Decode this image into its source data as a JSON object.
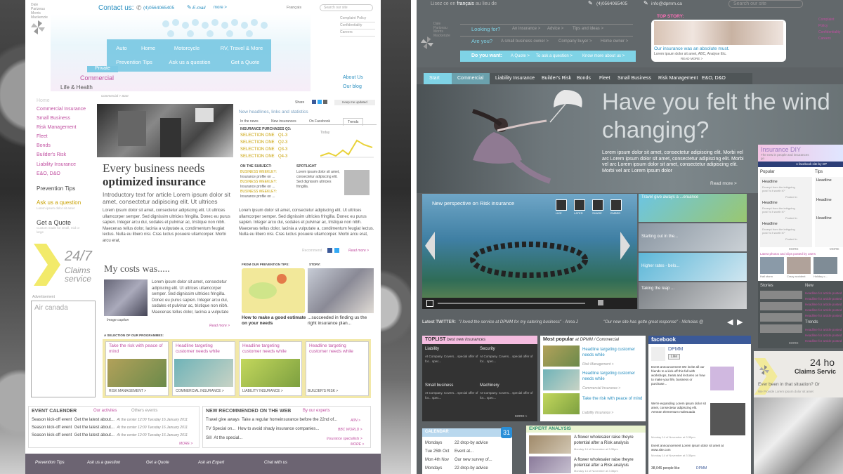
{
  "left": {
    "logo_lines": [
      "Dale",
      "Parizeau",
      "Morris",
      "Mackenzie"
    ],
    "contact_label": "Contact us:",
    "phone": "(4)0564065405",
    "email": "E-mail",
    "more": "more >",
    "lang": "Français",
    "search_placeholder": "Search our site",
    "util_links": [
      "Complaint Policy",
      "Confidentiality",
      "Careers"
    ],
    "nav_row1": [
      "Auto",
      "Home",
      "Motorcycle",
      "RV, Travel & More"
    ],
    "nav_row2": [
      "Prevention Tips",
      "Ask us a question",
      "Get a Quote"
    ],
    "private_tab": "Private",
    "commercial_tab": "Commercial",
    "life_tab": "Life & Health",
    "about_links": [
      "About Us",
      "Our blog"
    ],
    "breadcrumb": "Commercial > Start",
    "share": "Share",
    "keep_updated": "Keep me updated",
    "sidebar_items": [
      "Home",
      "Commercial Insurance",
      "Small Business",
      "Risk Management",
      "Fleet",
      "Bonds",
      "Builder's Risk",
      "Liability Insurance",
      "E&O, D&O"
    ],
    "prevention_tips": "Prevention Tips",
    "ask_question": "Ask us a question",
    "ask_sub": "Lorem ipsum dolor sit amet",
    "get_quote": "Get a Quote",
    "quote_sub": "Custom made for small, mid or large",
    "claims_num": "24/7",
    "claims_text1": "Claims",
    "claims_text2": "service",
    "advert_label": "Advertisement",
    "advert_name": "Air canada",
    "headline1": "Every business needs",
    "headline2": "optimized insurance",
    "intro": "Introductory text for article Lorem ipsum dolor sit amet, consectetur adipiscing elit. Ut ultrices",
    "body": "Lorem ipsum dolor sit amet, consectetur adipiscing elit. Ut ultrices ullamcorper semper. Sed dignissim ultricies fringilla. Donec eu purus sapien. Integer arcu dui, sodales et pulvinar ac, tristique non nibh. Maecenas tellus dolor, lacinia a vulputate a, condimentum feugiat lectus. Nulla eu libero nisi. Cras luctus posuere ullamcorper. Morbi arcu erat,",
    "news_title": "New headlines, links and statistics",
    "news_tabs": [
      "In the news",
      "New insurances",
      "On Facebook",
      "Trends"
    ],
    "purchases_title": "INSURANCE PURCHASES Q3:",
    "selections": [
      "SELECTION ONE",
      "SELECTION ONE",
      "SELECTION ONE",
      "SELECTION ONE"
    ],
    "quarters": [
      "Q1-3",
      "Q2-3",
      "Q3-3",
      "Q4-3"
    ],
    "today": "Today",
    "on_subject": "ON THE SUBJECT:",
    "spotlight": "SPOTLIGHT",
    "biz_weekly": "BUSINESS WEEKLEY:",
    "biz_text": "Insurance profile on ...",
    "spot_text": "Lorem ipsum dolor sit amet, consectetur adipiscing elit. Sed dignissim ultricies fringilla.",
    "news_body": "Lorem ipsum dolor sit amet, consectetur adipiscing elit. Ut ultrices ullamcorper semper. Sed dignissim ultricies fringilla. Donec eu purus sapien. Integer arcu dui, sodales et pulvinar ac, tristique non nibh. Maecenas tellus dolor, lacinia a vulputate a, condimentum feugiat lectus. Nulla eu libero nisi. Cras luctus posuere ullamcorper. Morbi arcu erat,",
    "recommend": "Recommend",
    "read_more": "Read more >",
    "costs_title": "My costs was.....",
    "costs_body": "Lorem ipsum dolor sit amet, consectetur adipiscing elit. Ut ultrices ullamcorper semper. Sed dignissim ultricies fringilla. Donec eu purus sapien. Integer arcu dui, sodales et pulvinar ac, tristique non nibh. Maecenas tellus dolor, lacinia a vulputate",
    "image_caption": "Image caption",
    "prev_tips_label": "FROM OUR PREVENTION TIPS:",
    "story_label": "STORY:",
    "prev_tips_text": "How to make a good estimate on your needs",
    "story_text": "...succeeded in finding us the right insurance plan...",
    "programmes_title": "A SELECTION OF OUR PROGRAMMES:",
    "programmes": [
      {
        "headline": "Take the risk with peace of mind",
        "label": "RISK MANAGEMENT >"
      },
      {
        "headline": "Headline targeting customer needs while",
        "label": "COMMERCIAL INSURANCE >"
      },
      {
        "headline": "Headline targeting customer needs while",
        "label": "LIABILITY INSURANCE >"
      },
      {
        "headline": "Headline targeting customer needs while",
        "label": "BUILDER'S RISK >"
      }
    ],
    "event_title": "EVENT CALENDER",
    "event_tabs": [
      "Our activites",
      "Others events"
    ],
    "events": [
      {
        "name": "Season kick-off event",
        "text": "Get the latest about...",
        "time": "At the center 12:00 Tuesday 16 January 2011"
      },
      {
        "name": "Season kick-off event",
        "text": "Get the latest about...",
        "time": "At the center 12:00 Tuesday 16 January 2011"
      },
      {
        "name": "Season kick-off event",
        "text": "Get the latest about...",
        "time": "At the center 12:00 Tuesday 16 January 2011"
      }
    ],
    "web_title": "NEW RECOMMENDED ON THE WEB",
    "web_tab": "By our experts",
    "web_items": [
      {
        "name": "Travel give aways",
        "text": "Take a regular homeinsurance before the 22nd of...",
        "src": "A0N >"
      },
      {
        "name": "TV Special on...",
        "text": "How to avoid shady insurance companies...",
        "src": "BBC WORLD >"
      },
      {
        "name": "Sill",
        "text": "At the special...",
        "src": "Insurance specialists >"
      }
    ],
    "more_caps": "MORE >",
    "footer_links": [
      "Prevention Tips",
      "Ask us a question",
      "Get a Quote",
      "Ask an Expert",
      "Chat with us"
    ]
  },
  "right": {
    "lang_text": "Lisez ce en",
    "lang_link": "français",
    "lang_tail": "au lieu de",
    "phone": "(4)0564065405",
    "email": "info@dpmm.ca",
    "search_placeholder": "Search our site",
    "util_links": [
      "Complaint Policy",
      "Confidentiality",
      "Careers"
    ],
    "logo_lines": [
      "Dale",
      "Parizeau",
      "Morris",
      "Mackenzie"
    ],
    "looking_for": "Looking for?",
    "looking_items": [
      "An insurance >",
      "Advice >",
      "Tips and ideas >"
    ],
    "are_you": "Are you?",
    "are_items": [
      "A small business owner >",
      "Company buyer >",
      "Home owner >"
    ],
    "want": "Do you want:",
    "want_items": [
      "A Quote >",
      "To ask a question >",
      "Know more about us >"
    ],
    "top_story": "TOP STORY:",
    "top_story_text1": "Our insurance was an absolute must.",
    "top_story_text2": "Lorem ipsum dolor sit amet, ABC, Analyse Etc.",
    "read_more_caps": "READ MORE >",
    "tabs": [
      "Start",
      "Commercial",
      "Liability Insurance",
      "Builder's Risk",
      "Bonds",
      "Fleet",
      "Small Business",
      "Risk Management",
      "E&O, D&O"
    ],
    "hero_line1": "Have you felt the wind",
    "hero_line2": "changing?",
    "hero_body": "Lorem ipsum dolor sit amet, consectetur adipiscing elit. Morbi vel arc Lorem ipsum dolor sit amet, consectetur adipiscing elit. Morbi vel arc Lorem ipsum dolor sit amet, consectetur adipiscing elit. Morbi vel arc Lorem ipsum dolor",
    "read_more": "Read more >",
    "video_title": "New perspective on Risk insurance",
    "video_controls": [
      "LIKE",
      "LATER",
      "SHARE",
      "EMBED"
    ],
    "video_thumbs": [
      "Travel give aways a ...eruance",
      "Starting out in the...",
      "Higher rates - belo...",
      "Taking the leap ..."
    ],
    "diy_title": "Insurance DIY",
    "diy_sub": "The new in people and insurances go",
    "diy_fb": "A facebook site by DP",
    "diy_cols": [
      "Popular",
      "Tips"
    ],
    "diy_headline": "Headline",
    "diy_excerpt": "Excerpt from the intriguing post 'Is it worth it?'",
    "diy_posted": "Posted in",
    "diy_more": "MORE",
    "photos_label": "Latest photos and clips posted by users",
    "photo_captions": [
      "Hail storm",
      "Crazy accident",
      "Holiday c..."
    ],
    "stories": "Stories",
    "new_label": "New",
    "trends": "Trends",
    "side_item": "Headline for article posted",
    "twitter_label": "Latest TWITTER:",
    "tweet1": "\"I loved the service at DPMM for my catering business\" - Anna J",
    "tweet2": "\"Our new site has gotte great response\" - Nicholas @",
    "toplist_title": "TOPLIST",
    "toplist_sub": "best new insurances",
    "toplist_cats": [
      "Liability",
      "Security",
      "Small business",
      "Machinery"
    ],
    "toplist_text": "At Company. Covers... special offer of for... spec...",
    "popular_title": "Most popular",
    "popular_sub": "at DPMM / Commercial",
    "popular_items": [
      "Headline targeting customer needs while",
      "Headline targeting customer needs while",
      "Take the risk with peace of mind"
    ],
    "popular_tags": [
      "Risk Management >",
      "Commercial Insurance >",
      "Liability Insurance >"
    ],
    "facebook": "facebook",
    "fb_page": "DPMM",
    "fb_like": "Like",
    "fb_post1": "Event announcement We invite all our friends to a kick-off this fall with workshops, treats and lectures on how to make your life, business or purchase...",
    "fb_post2": "We're expanding Lorem ipsum dolor sit amet, consectetur adipiscing elit. Aenean elementum malesuada",
    "fb_post3": "Event announcement Lorem ipsum dolor sit amet at www.site.com",
    "fb_date": "Monday 14 of November at 3:35pm",
    "fb_likes": "38,046 people like",
    "fb_likes_name": "DPMM",
    "more": "MORE >",
    "calendar_title": "CALENDAR",
    "calendar_num": "31",
    "calendar": [
      {
        "day": "Mondays",
        "text": "22 drop-by advice"
      },
      {
        "day": "Tue 25th Oct",
        "text": "Event at..."
      },
      {
        "day": "Mon 4th Nov",
        "text": "Our new survey of..."
      },
      {
        "day": "Mondays",
        "text": "22 drop-by advice"
      }
    ],
    "expert_title": "EXPERT ANALYSIS",
    "expert_items": [
      "A flower wholesaler raise theyre potential after a Risk analysis",
      "A flower wholesaler raise theyre potential after a Risk analysis"
    ],
    "expert_date": "Monday 14 of November at 3:35pm",
    "claims_num": "24 ho",
    "claims_text": "Claims Servic",
    "claims_q": "Ever been in that situation? Or",
    "claims_sub": "We Provide Lorem ipsum dolor sit amet"
  }
}
